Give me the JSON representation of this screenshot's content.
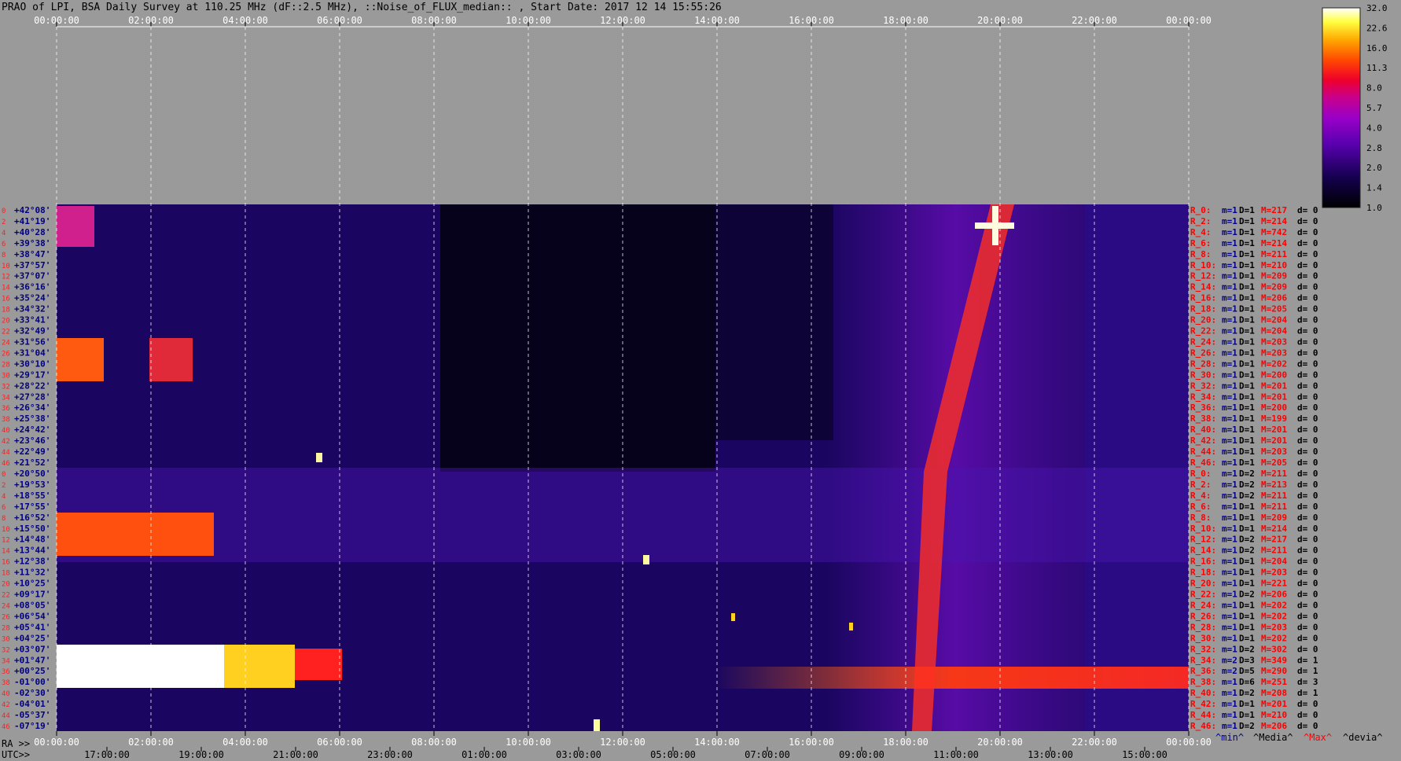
{
  "title": "PRAO of LPI, BSA Daily Survey at 110.25 MHz (dF::2.5 MHz), ::Noise_of_FLUX_median:: , Start Date: 2017 12 14 15:55:26",
  "chart_data": {
    "type": "heatmap",
    "top_axis_ticks": [
      "00:00:00",
      "02:00:00",
      "04:00:00",
      "06:00:00",
      "08:00:00",
      "10:00:00",
      "12:00:00",
      "14:00:00",
      "16:00:00",
      "18:00:00",
      "20:00:00",
      "22:00:00",
      "00:00:00"
    ],
    "ra_axis_label": "RA >>",
    "ra_ticks": [
      "00:00:00",
      "02:00:00",
      "04:00:00",
      "06:00:00",
      "08:00:00",
      "10:00:00",
      "12:00:00",
      "14:00:00",
      "16:00:00",
      "18:00:00",
      "20:00:00",
      "22:00:00",
      "00:00:00"
    ],
    "utc_axis_label": "UTC>>",
    "utc_ticks": [
      "17:00:00",
      "19:00:00",
      "21:00:00",
      "23:00:00",
      "01:00:00",
      "03:00:00",
      "05:00:00",
      "07:00:00",
      "09:00:00",
      "11:00:00",
      "13:00:00",
      "15:00:00"
    ],
    "colorbar_ticks": [
      "32.0",
      "22.6",
      "16.0",
      "11.3",
      "8.0",
      "5.7",
      "4.0",
      "2.8",
      "2.0",
      "1.4",
      "1.0"
    ],
    "declinations": [
      "+42°08'",
      "+41°19'",
      "+40°28'",
      "+39°38'",
      "+38°47'",
      "+37°57'",
      "+37°07'",
      "+36°16'",
      "+35°24'",
      "+34°32'",
      "+33°41'",
      "+32°49'",
      "+31°56'",
      "+31°04'",
      "+30°10'",
      "+29°17'",
      "+28°22'",
      "+27°28'",
      "+26°34'",
      "+25°38'",
      "+24°42'",
      "+23°46'",
      "+22°49'",
      "+21°52'",
      "+20°50'",
      "+19°53'",
      "+18°55'",
      "+17°55'",
      "+16°52'",
      "+15°50'",
      "+14°48'",
      "+13°44'",
      "+12°38'",
      "+11°32'",
      "+10°25'",
      "+09°17'",
      "+08°05'",
      "+06°54'",
      "+05°41'",
      "+04°25'",
      "+03°07'",
      "+01°47'",
      "+00°25'",
      "-01°00'",
      "-02°30'",
      "-04°01'",
      "-05°37'",
      "-07°19'"
    ],
    "row_indices": [
      "0",
      "2",
      "4",
      "6",
      "8",
      "10",
      "12",
      "14",
      "16",
      "18",
      "20",
      "22",
      "24",
      "26",
      "28",
      "30",
      "32",
      "34",
      "36",
      "38",
      "40",
      "42",
      "44",
      "46",
      "0",
      "2",
      "4",
      "6",
      "8",
      "10",
      "12",
      "14",
      "16",
      "18",
      "20",
      "22",
      "24",
      "26",
      "28",
      "30",
      "32",
      "34",
      "36",
      "38",
      "40",
      "42",
      "44",
      "46"
    ],
    "right_labels": [
      {
        "r": "R_0:",
        "m": "m=1",
        "d": "D=1",
        "M": "M=217",
        "dev": "d= 0"
      },
      {
        "r": "R_2:",
        "m": "m=1",
        "d": "D=1",
        "M": "M=214",
        "dev": "d= 0"
      },
      {
        "r": "R_4:",
        "m": "m=1",
        "d": "D=1",
        "M": "M=742",
        "dev": "d= 0"
      },
      {
        "r": "R_6:",
        "m": "m=1",
        "d": "D=1",
        "M": "M=214",
        "dev": "d= 0"
      },
      {
        "r": "R_8:",
        "m": "m=1",
        "d": "D=1",
        "M": "M=211",
        "dev": "d= 0"
      },
      {
        "r": "R_10:",
        "m": "m=1",
        "d": "D=1",
        "M": "M=210",
        "dev": "d= 0"
      },
      {
        "r": "R_12:",
        "m": "m=1",
        "d": "D=1",
        "M": "M=209",
        "dev": "d= 0"
      },
      {
        "r": "R_14:",
        "m": "m=1",
        "d": "D=1",
        "M": "M=209",
        "dev": "d= 0"
      },
      {
        "r": "R_16:",
        "m": "m=1",
        "d": "D=1",
        "M": "M=206",
        "dev": "d= 0"
      },
      {
        "r": "R_18:",
        "m": "m=1",
        "d": "D=1",
        "M": "M=205",
        "dev": "d= 0"
      },
      {
        "r": "R_20:",
        "m": "m=1",
        "d": "D=1",
        "M": "M=204",
        "dev": "d= 0"
      },
      {
        "r": "R_22:",
        "m": "m=1",
        "d": "D=1",
        "M": "M=204",
        "dev": "d= 0"
      },
      {
        "r": "R_24:",
        "m": "m=1",
        "d": "D=1",
        "M": "M=203",
        "dev": "d= 0"
      },
      {
        "r": "R_26:",
        "m": "m=1",
        "d": "D=1",
        "M": "M=203",
        "dev": "d= 0"
      },
      {
        "r": "R_28:",
        "m": "m=1",
        "d": "D=1",
        "M": "M=202",
        "dev": "d= 0"
      },
      {
        "r": "R_30:",
        "m": "m=1",
        "d": "D=1",
        "M": "M=200",
        "dev": "d= 0"
      },
      {
        "r": "R_32:",
        "m": "m=1",
        "d": "D=1",
        "M": "M=201",
        "dev": "d= 0"
      },
      {
        "r": "R_34:",
        "m": "m=1",
        "d": "D=1",
        "M": "M=201",
        "dev": "d= 0"
      },
      {
        "r": "R_36:",
        "m": "m=1",
        "d": "D=1",
        "M": "M=200",
        "dev": "d= 0"
      },
      {
        "r": "R_38:",
        "m": "m=1",
        "d": "D=1",
        "M": "M=199",
        "dev": "d= 0"
      },
      {
        "r": "R_40:",
        "m": "m=1",
        "d": "D=1",
        "M": "M=201",
        "dev": "d= 0"
      },
      {
        "r": "R_42:",
        "m": "m=1",
        "d": "D=1",
        "M": "M=201",
        "dev": "d= 0"
      },
      {
        "r": "R_44:",
        "m": "m=1",
        "d": "D=1",
        "M": "M=203",
        "dev": "d= 0"
      },
      {
        "r": "R_46:",
        "m": "m=1",
        "d": "D=1",
        "M": "M=205",
        "dev": "d= 0"
      },
      {
        "r": "R_0:",
        "m": "m=1",
        "d": "D=2",
        "M": "M=211",
        "dev": "d= 0"
      },
      {
        "r": "R_2:",
        "m": "m=1",
        "d": "D=2",
        "M": "M=213",
        "dev": "d= 0"
      },
      {
        "r": "R_4:",
        "m": "m=1",
        "d": "D=2",
        "M": "M=211",
        "dev": "d= 0"
      },
      {
        "r": "R_6:",
        "m": "m=1",
        "d": "D=1",
        "M": "M=211",
        "dev": "d= 0"
      },
      {
        "r": "R_8:",
        "m": "m=1",
        "d": "D=1",
        "M": "M=209",
        "dev": "d= 0"
      },
      {
        "r": "R_10:",
        "m": "m=1",
        "d": "D=1",
        "M": "M=214",
        "dev": "d= 0"
      },
      {
        "r": "R_12:",
        "m": "m=1",
        "d": "D=2",
        "M": "M=217",
        "dev": "d= 0"
      },
      {
        "r": "R_14:",
        "m": "m=1",
        "d": "D=2",
        "M": "M=211",
        "dev": "d= 0"
      },
      {
        "r": "R_16:",
        "m": "m=1",
        "d": "D=1",
        "M": "M=204",
        "dev": "d= 0"
      },
      {
        "r": "R_18:",
        "m": "m=1",
        "d": "D=1",
        "M": "M=203",
        "dev": "d= 0"
      },
      {
        "r": "R_20:",
        "m": "m=1",
        "d": "D=1",
        "M": "M=221",
        "dev": "d= 0"
      },
      {
        "r": "R_22:",
        "m": "m=1",
        "d": "D=2",
        "M": "M=206",
        "dev": "d= 0"
      },
      {
        "r": "R_24:",
        "m": "m=1",
        "d": "D=1",
        "M": "M=202",
        "dev": "d= 0"
      },
      {
        "r": "R_26:",
        "m": "m=1",
        "d": "D=1",
        "M": "M=202",
        "dev": "d= 0"
      },
      {
        "r": "R_28:",
        "m": "m=1",
        "d": "D=1",
        "M": "M=203",
        "dev": "d= 0"
      },
      {
        "r": "R_30:",
        "m": "m=1",
        "d": "D=1",
        "M": "M=202",
        "dev": "d= 0"
      },
      {
        "r": "R_32:",
        "m": "m=1",
        "d": "D=2",
        "M": "M=302",
        "dev": "d= 0"
      },
      {
        "r": "R_34:",
        "m": "m=2",
        "d": "D=3",
        "M": "M=349",
        "dev": "d= 1"
      },
      {
        "r": "R_36:",
        "m": "m=2",
        "d": "D=5",
        "M": "M=290",
        "dev": "d= 1"
      },
      {
        "r": "R_38:",
        "m": "m=1",
        "d": "D=6",
        "M": "M=251",
        "dev": "d= 3"
      },
      {
        "r": "R_40:",
        "m": "m=1",
        "d": "D=2",
        "M": "M=208",
        "dev": "d= 1"
      },
      {
        "r": "R_42:",
        "m": "m=1",
        "d": "D=1",
        "M": "M=201",
        "dev": "d= 0"
      },
      {
        "r": "R_44:",
        "m": "m=1",
        "d": "D=1",
        "M": "M=210",
        "dev": "d= 0"
      },
      {
        "r": "R_46:",
        "m": "m=1",
        "d": "D=2",
        "M": "M=206",
        "dev": "d= 0"
      }
    ],
    "legend": {
      "min": "^min^",
      "media": "^Media^",
      "max": "^Max^",
      "devia": "^devia^"
    },
    "colors": {
      "background": "#9a9a9a",
      "min": "#00008b",
      "max": "#ff0000",
      "text": "#000000"
    }
  }
}
